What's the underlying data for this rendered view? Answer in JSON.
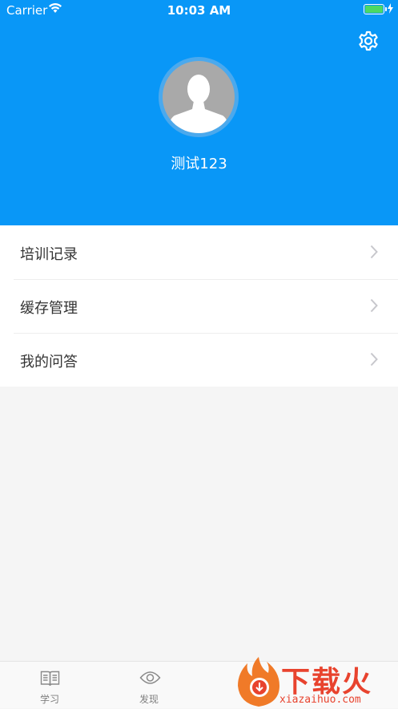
{
  "status_bar": {
    "carrier": "Carrier",
    "time": "10:03 AM",
    "battery_level": 1.0
  },
  "profile": {
    "username": "测试123"
  },
  "menu": {
    "items": [
      {
        "label": "培训记录"
      },
      {
        "label": "缓存管理"
      },
      {
        "label": "我的问答"
      }
    ]
  },
  "tabs": [
    {
      "label": "学习",
      "icon": "book-icon"
    },
    {
      "label": "发现",
      "icon": "eye-icon"
    }
  ],
  "watermark": {
    "title": "下载火",
    "site": "xiazaihuo.com"
  },
  "colors": {
    "header": "#0997f7",
    "watermark": "#e8432e"
  }
}
